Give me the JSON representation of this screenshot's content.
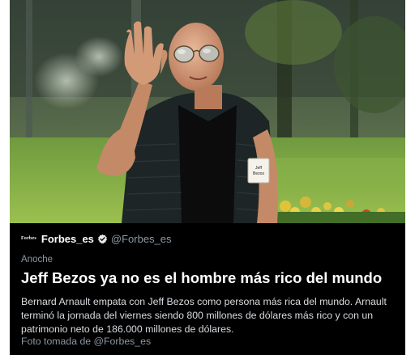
{
  "photo": {
    "badge_line1": "Jeff",
    "badge_line2": "Bezos"
  },
  "source": {
    "logo_text": "Forbes",
    "account_name": "Forbes_es",
    "handle": "@Forbes_es",
    "verified_icon": "verified-check-icon"
  },
  "post": {
    "time": "Anoche",
    "headline": "Jeff Bezos ya no es el hombre más rico del mundo",
    "summary": "Bernard Arnault empata con Jeff Bezos como persona más rica del mundo. Arnault terminó la jornada del viernes siendo 800 millones de dólares más rico y con un patrimonio neto de 186.000 millones de dólares.",
    "credit": "Foto tomada de @Forbes_es"
  },
  "colors": {
    "background": "#000000",
    "text_primary": "#ffffff",
    "text_secondary": "#8b98a5"
  }
}
